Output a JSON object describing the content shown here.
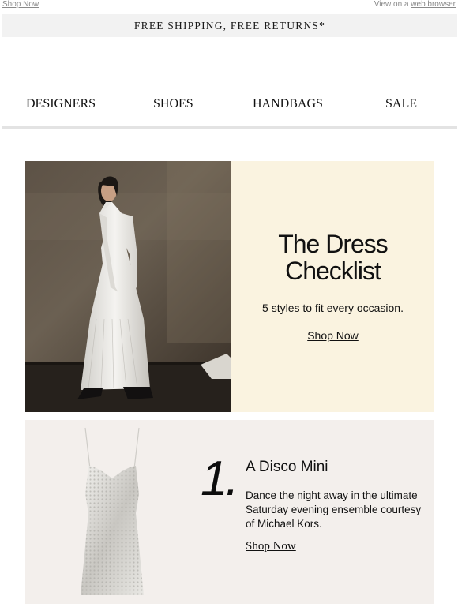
{
  "topbar": {
    "shop_now": "Shop Now",
    "view_prefix": "View on a ",
    "web_browser": "web browser"
  },
  "shipping_banner": "FREE SHIPPING, FREE RETURNS*",
  "nav": {
    "items": [
      "DESIGNERS",
      "SHOES",
      "HANDBAGS",
      "SALE"
    ]
  },
  "hero": {
    "title_line1": "The Dress",
    "title_line2": "Checklist",
    "subtitle": "5 styles to fit every occasion.",
    "cta": "Shop Now"
  },
  "item1": {
    "number": "1.",
    "title": "A Disco Mini",
    "description": "Dance the night away in the ultimate Saturday evening ensemble courtesy of Michael Kors.",
    "cta": "Shop Now"
  }
}
